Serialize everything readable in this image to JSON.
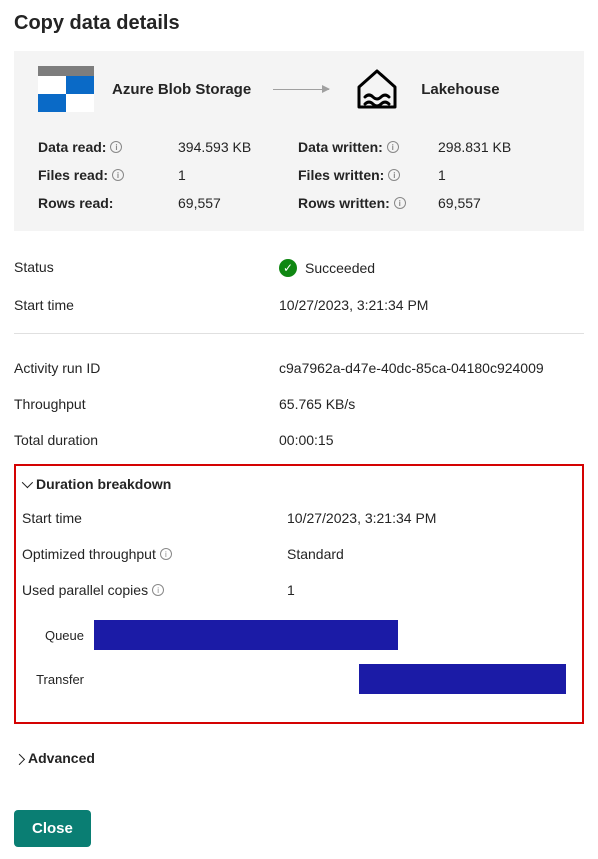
{
  "title": "Copy data details",
  "transfer": {
    "source_label": "Azure Blob Storage",
    "dest_label": "Lakehouse"
  },
  "metrics": {
    "data_read_label": "Data read:",
    "data_read_value": "394.593 KB",
    "files_read_label": "Files read:",
    "files_read_value": "1",
    "rows_read_label": "Rows read:",
    "rows_read_value": "69,557",
    "data_written_label": "Data written:",
    "data_written_value": "298.831 KB",
    "files_written_label": "Files written:",
    "files_written_value": "1",
    "rows_written_label": "Rows written:",
    "rows_written_value": "69,557"
  },
  "status": {
    "label": "Status",
    "value": "Succeeded"
  },
  "start_time": {
    "label": "Start time",
    "value": "10/27/2023, 3:21:34 PM"
  },
  "run_id": {
    "label": "Activity run ID",
    "value": "c9a7962a-d47e-40dc-85ca-04180c924009"
  },
  "throughput": {
    "label": "Throughput",
    "value": "65.765 KB/s"
  },
  "total_duration": {
    "label": "Total duration",
    "value": "00:00:15"
  },
  "breakdown": {
    "header": "Duration breakdown",
    "start_time_label": "Start time",
    "start_time_value": "10/27/2023, 3:21:34 PM",
    "opt_throughput_label": "Optimized throughput",
    "opt_throughput_value": "Standard",
    "parallel_label": "Used parallel copies",
    "parallel_value": "1"
  },
  "chart_data": {
    "type": "bar",
    "orientation": "horizontal",
    "title": "",
    "categories": [
      "Queue",
      "Transfer"
    ],
    "series": [
      {
        "name": "Queue",
        "start_pct": 0,
        "width_pct": 63
      },
      {
        "name": "Transfer",
        "start_pct": 55,
        "width_pct": 43
      }
    ]
  },
  "advanced_label": "Advanced",
  "close_label": "Close"
}
